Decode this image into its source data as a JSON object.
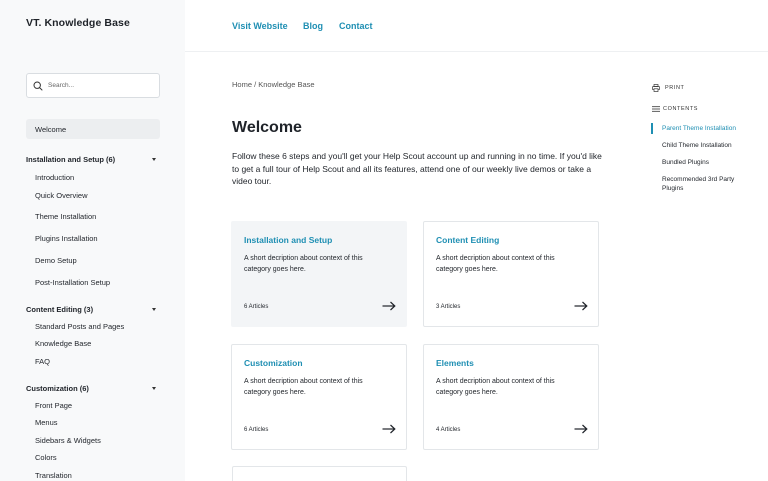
{
  "sidebar": {
    "brand": "VT. Knowledge Base",
    "search_placeholder": "Search...",
    "welcome": "Welcome",
    "groups": [
      {
        "label": "Installation and Setup (6)",
        "items": [
          "Introduction",
          "Quick Overview",
          "Theme Installation",
          "Plugins Installation",
          "Demo Setup",
          "Post-Installation Setup"
        ]
      },
      {
        "label": "Content Editing (3)",
        "items": [
          "Standard Posts and Pages",
          "Knowledge Base",
          "FAQ"
        ]
      },
      {
        "label": "Customization (6)",
        "items": [
          "Front Page",
          "Menus",
          "Sidebars & Widgets",
          "Colors",
          "Translation"
        ]
      }
    ]
  },
  "topnav": {
    "visit": "Visit Website",
    "blog": "Blog",
    "contact": "Contact"
  },
  "main": {
    "breadcrumb": "Home / Knowledge Base",
    "title": "Welcome",
    "intro": "Follow these 6 steps and you'll get your Help Scout account up and running in no time. If you'd like to get a full tour of Help Scout and all its features, attend one of our weekly live demos or take a video tour.",
    "cards": [
      {
        "title": "Installation and Setup",
        "desc": "A short decription about context of this category goes here.",
        "count": "6 Articles"
      },
      {
        "title": "Content Editing",
        "desc": "A short decription about context of this category goes here.",
        "count": "3 Articles"
      },
      {
        "title": "Customization",
        "desc": "A short decription about context of this category goes here.",
        "count": "6 Articles"
      },
      {
        "title": "Elements",
        "desc": "A short decription about context of this category goes here.",
        "count": "4 Articles"
      }
    ]
  },
  "toc": {
    "print": "PRINT",
    "contents": "CONTENTS",
    "items": [
      "Parent Theme Installation",
      "Child Theme Installation",
      "Bundled Plugins",
      "Recommended 3rd Party Plugins"
    ]
  },
  "colors": {
    "accent": "#1f8fb3",
    "sidebar_bg": "#f8f9fa",
    "active_card_bg": "#f3f5f7"
  }
}
